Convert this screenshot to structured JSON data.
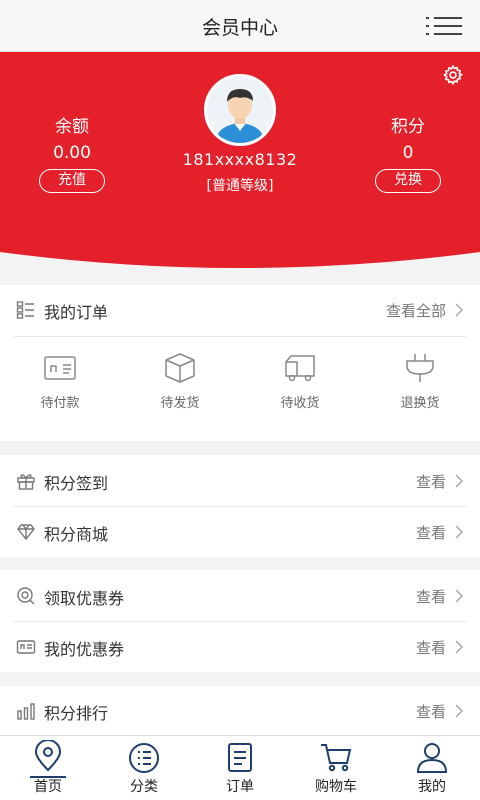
{
  "header": {
    "title": "会员中心",
    "menu_icon": "menu-icon"
  },
  "profile": {
    "balance_label": "余额",
    "balance_value": "0.00",
    "recharge_label": "充值",
    "points_label": "积分",
    "points_value": "0",
    "redeem_label": "兑换",
    "phone": "181xxxx8132",
    "level": "[普通等级]",
    "accent_color": "#e4202b"
  },
  "orders": {
    "title": "我的订单",
    "view_all": "查看全部",
    "items": [
      {
        "label": "待付款",
        "icon": "payment-card-icon"
      },
      {
        "label": "待发货",
        "icon": "package-box-icon"
      },
      {
        "label": "待收货",
        "icon": "delivery-truck-icon"
      },
      {
        "label": "退换货",
        "icon": "plug-return-icon"
      }
    ]
  },
  "points_section": [
    {
      "label": "积分签到",
      "action": "查看",
      "icon": "gift-icon"
    },
    {
      "label": "积分商城",
      "action": "查看",
      "icon": "diamond-icon"
    }
  ],
  "coupon_section": [
    {
      "label": "领取优惠券",
      "action": "查看",
      "icon": "coupon-search-icon"
    },
    {
      "label": "我的优惠券",
      "action": "查看",
      "icon": "coupon-card-icon"
    }
  ],
  "ranking": {
    "label": "积分排行",
    "action": "查看",
    "icon": "bar-chart-icon"
  },
  "tabbar": {
    "items": [
      {
        "label": "首页",
        "icon": "location-pin-icon"
      },
      {
        "label": "分类",
        "icon": "category-list-icon"
      },
      {
        "label": "订单",
        "icon": "order-document-icon"
      },
      {
        "label": "购物车",
        "icon": "shopping-cart-icon"
      },
      {
        "label": "我的",
        "icon": "user-profile-icon"
      }
    ]
  }
}
